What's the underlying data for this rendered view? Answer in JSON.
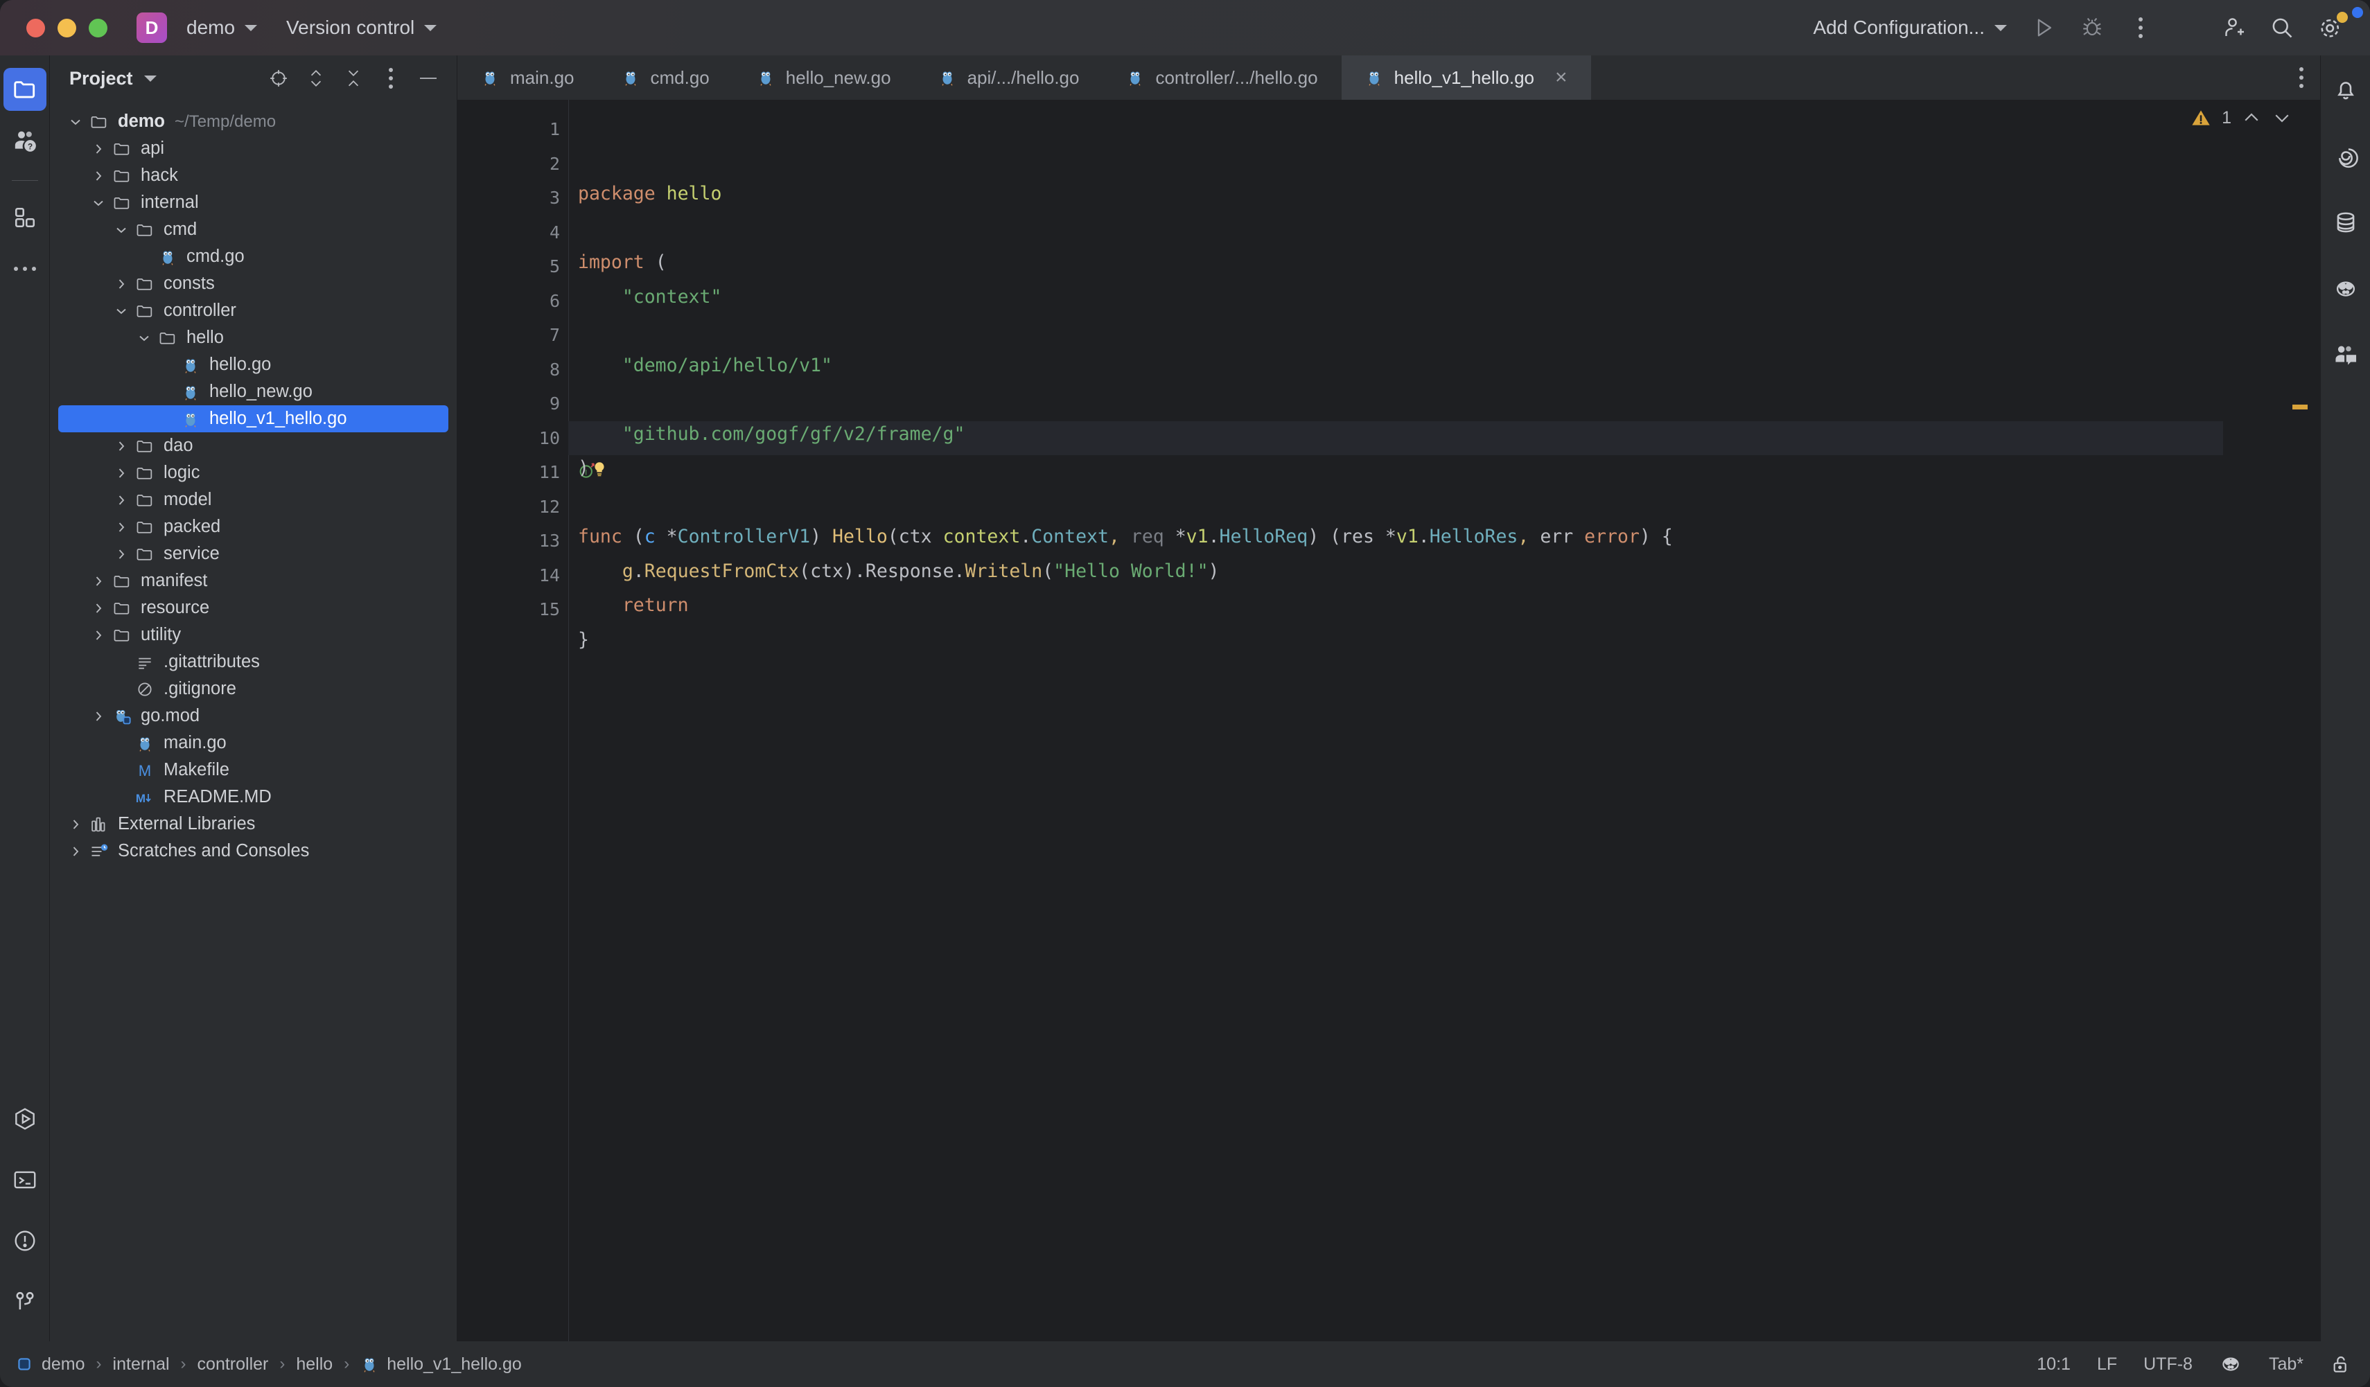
{
  "titlebar": {
    "project_badge_letter": "D",
    "project_name": "demo",
    "version_control_label": "Version control",
    "run_config_label": "Add Configuration...",
    "icons": {
      "run": "run-icon",
      "debug": "debug-icon",
      "more": "more-options-icon",
      "add_user": "add-user-icon",
      "search": "search-icon",
      "settings": "settings-icon"
    }
  },
  "left_rail": {
    "items": [
      {
        "name": "project-tool-window",
        "icon": "folder-icon",
        "active": true
      },
      {
        "name": "ai-assistant",
        "icon": "people-help-icon",
        "active": false
      },
      {
        "name": "plugins",
        "icon": "plugins-icon",
        "active": false
      },
      {
        "name": "more-tool-windows",
        "icon": "ellipsis-icon",
        "active": false
      }
    ],
    "bottom_items": [
      {
        "name": "run-tool-window",
        "icon": "run-hex-icon"
      },
      {
        "name": "terminal-tool-window",
        "icon": "terminal-icon"
      },
      {
        "name": "problems-tool-window",
        "icon": "warning-circle-icon"
      },
      {
        "name": "version-control-tool-window",
        "icon": "branch-icon"
      }
    ]
  },
  "project_panel": {
    "title": "Project",
    "header_icons": [
      {
        "name": "select-opened-file-icon",
        "glyph": "target"
      },
      {
        "name": "expand-collapse-icon",
        "glyph": "updown"
      },
      {
        "name": "collapse-all-icon",
        "glyph": "collapse"
      },
      {
        "name": "options-icon",
        "glyph": "kebab"
      },
      {
        "name": "hide-icon",
        "glyph": "minus"
      }
    ],
    "tree": [
      {
        "label": "demo",
        "path": "~/Temp/demo",
        "indent": 0,
        "arrow": "down",
        "icon": "folder-icon",
        "bold": true
      },
      {
        "label": "api",
        "indent": 1,
        "arrow": "right",
        "icon": "folder-icon"
      },
      {
        "label": "hack",
        "indent": 1,
        "arrow": "right",
        "icon": "folder-icon"
      },
      {
        "label": "internal",
        "indent": 1,
        "arrow": "down",
        "icon": "folder-icon"
      },
      {
        "label": "cmd",
        "indent": 2,
        "arrow": "down",
        "icon": "folder-icon"
      },
      {
        "label": "cmd.go",
        "indent": 3,
        "arrow": "none",
        "icon": "go-file-icon"
      },
      {
        "label": "consts",
        "indent": 2,
        "arrow": "right",
        "icon": "folder-icon"
      },
      {
        "label": "controller",
        "indent": 2,
        "arrow": "down",
        "icon": "folder-icon"
      },
      {
        "label": "hello",
        "indent": 3,
        "arrow": "down",
        "icon": "folder-icon"
      },
      {
        "label": "hello.go",
        "indent": 4,
        "arrow": "none",
        "icon": "go-file-icon"
      },
      {
        "label": "hello_new.go",
        "indent": 4,
        "arrow": "none",
        "icon": "go-file-icon"
      },
      {
        "label": "hello_v1_hello.go",
        "indent": 4,
        "arrow": "none",
        "icon": "go-file-icon",
        "selected": true
      },
      {
        "label": "dao",
        "indent": 2,
        "arrow": "right",
        "icon": "folder-icon"
      },
      {
        "label": "logic",
        "indent": 2,
        "arrow": "right",
        "icon": "folder-icon"
      },
      {
        "label": "model",
        "indent": 2,
        "arrow": "right",
        "icon": "folder-icon"
      },
      {
        "label": "packed",
        "indent": 2,
        "arrow": "right",
        "icon": "folder-icon"
      },
      {
        "label": "service",
        "indent": 2,
        "arrow": "right",
        "icon": "folder-icon"
      },
      {
        "label": "manifest",
        "indent": 1,
        "arrow": "right",
        "icon": "folder-icon"
      },
      {
        "label": "resource",
        "indent": 1,
        "arrow": "right",
        "icon": "folder-icon"
      },
      {
        "label": "utility",
        "indent": 1,
        "arrow": "right",
        "icon": "folder-icon"
      },
      {
        "label": ".gitattributes",
        "indent": 2,
        "arrow": "none",
        "icon": "text-file-icon"
      },
      {
        "label": ".gitignore",
        "indent": 2,
        "arrow": "none",
        "icon": "ignore-file-icon"
      },
      {
        "label": "go.mod",
        "indent": 1,
        "arrow": "right",
        "icon": "go-mod-icon"
      },
      {
        "label": "main.go",
        "indent": 2,
        "arrow": "none",
        "icon": "go-file-icon"
      },
      {
        "label": "Makefile",
        "indent": 2,
        "arrow": "none",
        "icon": "makefile-icon"
      },
      {
        "label": "README.MD",
        "indent": 2,
        "arrow": "none",
        "icon": "markdown-icon"
      },
      {
        "label": "External Libraries",
        "indent": 0,
        "arrow": "right",
        "icon": "library-icon"
      },
      {
        "label": "Scratches and Consoles",
        "indent": 0,
        "arrow": "right",
        "icon": "scratches-icon"
      }
    ]
  },
  "editor": {
    "tabs": [
      {
        "label": "main.go",
        "icon": "go-file-icon",
        "active": false
      },
      {
        "label": "cmd.go",
        "icon": "go-file-icon",
        "active": false
      },
      {
        "label": "hello_new.go",
        "icon": "go-file-icon",
        "active": false
      },
      {
        "label": "api/.../hello.go",
        "icon": "go-file-icon",
        "active": false
      },
      {
        "label": "controller/.../hello.go",
        "icon": "go-file-icon",
        "active": false
      },
      {
        "label": "hello_v1_hello.go",
        "icon": "go-file-icon",
        "active": true,
        "closable": true
      }
    ],
    "inspection": {
      "warning_count": "1",
      "up_icon": "chevron-up-icon",
      "down_icon": "chevron-down-icon"
    },
    "tab_options_icon": "kebab-icon",
    "caret_line": 10,
    "line_numbers": [
      "1",
      "2",
      "3",
      "4",
      "5",
      "6",
      "7",
      "8",
      "9",
      "10",
      "11",
      "12",
      "13",
      "14",
      "15"
    ],
    "lines": [
      {
        "n": 1,
        "tokens": [
          {
            "t": "package ",
            "c": "kw"
          },
          {
            "t": "hello",
            "c": "prm"
          }
        ]
      },
      {
        "n": 2,
        "tokens": []
      },
      {
        "n": 3,
        "tokens": [
          {
            "t": "import ",
            "c": "kw"
          },
          {
            "t": "(",
            "c": "punc"
          }
        ]
      },
      {
        "n": 4,
        "tokens": [
          {
            "t": "    \"context\"",
            "c": "str"
          }
        ]
      },
      {
        "n": 5,
        "tokens": []
      },
      {
        "n": 6,
        "tokens": [
          {
            "t": "    \"demo/api/hello/v1\"",
            "c": "str"
          }
        ]
      },
      {
        "n": 7,
        "tokens": []
      },
      {
        "n": 8,
        "tokens": [
          {
            "t": "    \"github.com/gogf/gf/v2/frame/g\"",
            "c": "str"
          }
        ]
      },
      {
        "n": 9,
        "tokens": [
          {
            "t": ")",
            "c": "punc"
          }
        ],
        "bulb": true
      },
      {
        "n": 10,
        "tokens": []
      },
      {
        "n": 11,
        "gutter_icon": "implements-icon",
        "tokens": [
          {
            "t": "func ",
            "c": "kw"
          },
          {
            "t": "(",
            "c": "punc"
          },
          {
            "t": "c ",
            "c": "typ"
          },
          {
            "t": "*",
            "c": "punc"
          },
          {
            "t": "ControllerV1",
            "c": "bl2"
          },
          {
            "t": ") ",
            "c": "punc"
          },
          {
            "t": "Hello",
            "c": "fn"
          },
          {
            "t": "(",
            "c": "punc"
          },
          {
            "t": "ctx ",
            "c": "pln"
          },
          {
            "t": "context",
            "c": "prm"
          },
          {
            "t": ".",
            "c": "punc"
          },
          {
            "t": "Context",
            "c": "bl2"
          },
          {
            "t": ", ",
            "c": "ylw"
          },
          {
            "t": "req ",
            "c": "grey"
          },
          {
            "t": "*",
            "c": "punc"
          },
          {
            "t": "v1",
            "c": "prm"
          },
          {
            "t": ".",
            "c": "punc"
          },
          {
            "t": "HelloReq",
            "c": "bl2"
          },
          {
            "t": ") (",
            "c": "punc"
          },
          {
            "t": "res ",
            "c": "pln"
          },
          {
            "t": "*",
            "c": "punc"
          },
          {
            "t": "v1",
            "c": "prm"
          },
          {
            "t": ".",
            "c": "punc"
          },
          {
            "t": "HelloRes",
            "c": "bl2"
          },
          {
            "t": ", ",
            "c": "ylw"
          },
          {
            "t": "err ",
            "c": "pln"
          },
          {
            "t": "error",
            "c": "kw"
          },
          {
            "t": ") {",
            "c": "punc"
          }
        ]
      },
      {
        "n": 12,
        "tokens": [
          {
            "t": "    ",
            "c": "pln"
          },
          {
            "t": "g",
            "c": "ylw"
          },
          {
            "t": ".",
            "c": "punc"
          },
          {
            "t": "RequestFromCtx",
            "c": "ylw"
          },
          {
            "t": "(",
            "c": "punc"
          },
          {
            "t": "ctx",
            "c": "pln"
          },
          {
            "t": ").",
            "c": "punc"
          },
          {
            "t": "Response",
            "c": "pln"
          },
          {
            "t": ".",
            "c": "punc"
          },
          {
            "t": "Writeln",
            "c": "ylw"
          },
          {
            "t": "(",
            "c": "punc"
          },
          {
            "t": "\"Hello World!\"",
            "c": "str"
          },
          {
            "t": ")",
            "c": "punc"
          }
        ]
      },
      {
        "n": 13,
        "tokens": [
          {
            "t": "    ",
            "c": "pln"
          },
          {
            "t": "return",
            "c": "kw"
          }
        ]
      },
      {
        "n": 14,
        "tokens": [
          {
            "t": "}",
            "c": "punc"
          }
        ]
      },
      {
        "n": 15,
        "tokens": []
      }
    ]
  },
  "right_rail": {
    "items": [
      {
        "name": "notifications",
        "icon": "bell-icon",
        "badge": true
      },
      {
        "name": "ai-chat",
        "icon": "spiral-icon"
      },
      {
        "name": "database",
        "icon": "database-icon"
      },
      {
        "name": "gopher-tool",
        "icon": "gopher-icon"
      },
      {
        "name": "code-with-me",
        "icon": "people-chat-icon"
      }
    ]
  },
  "status_bar": {
    "breadcrumb": [
      {
        "label": "demo",
        "icon": "module-icon"
      },
      {
        "label": "internal",
        "icon": null
      },
      {
        "label": "controller",
        "icon": null
      },
      {
        "label": "hello",
        "icon": null
      },
      {
        "label": "hello_v1_hello.go",
        "icon": "go-file-icon"
      }
    ],
    "separator": "›",
    "caret_position": "10:1",
    "line_separator": "LF",
    "encoding": "UTF-8",
    "go_icon": "gopher-icon",
    "indent": "Tab*",
    "lock_icon": "unlocked-icon"
  },
  "colors": {
    "accent": "#3573f0",
    "warning": "#d9a33b",
    "window_bg": "#2b2d30",
    "editor_bg": "#1e1f22"
  }
}
